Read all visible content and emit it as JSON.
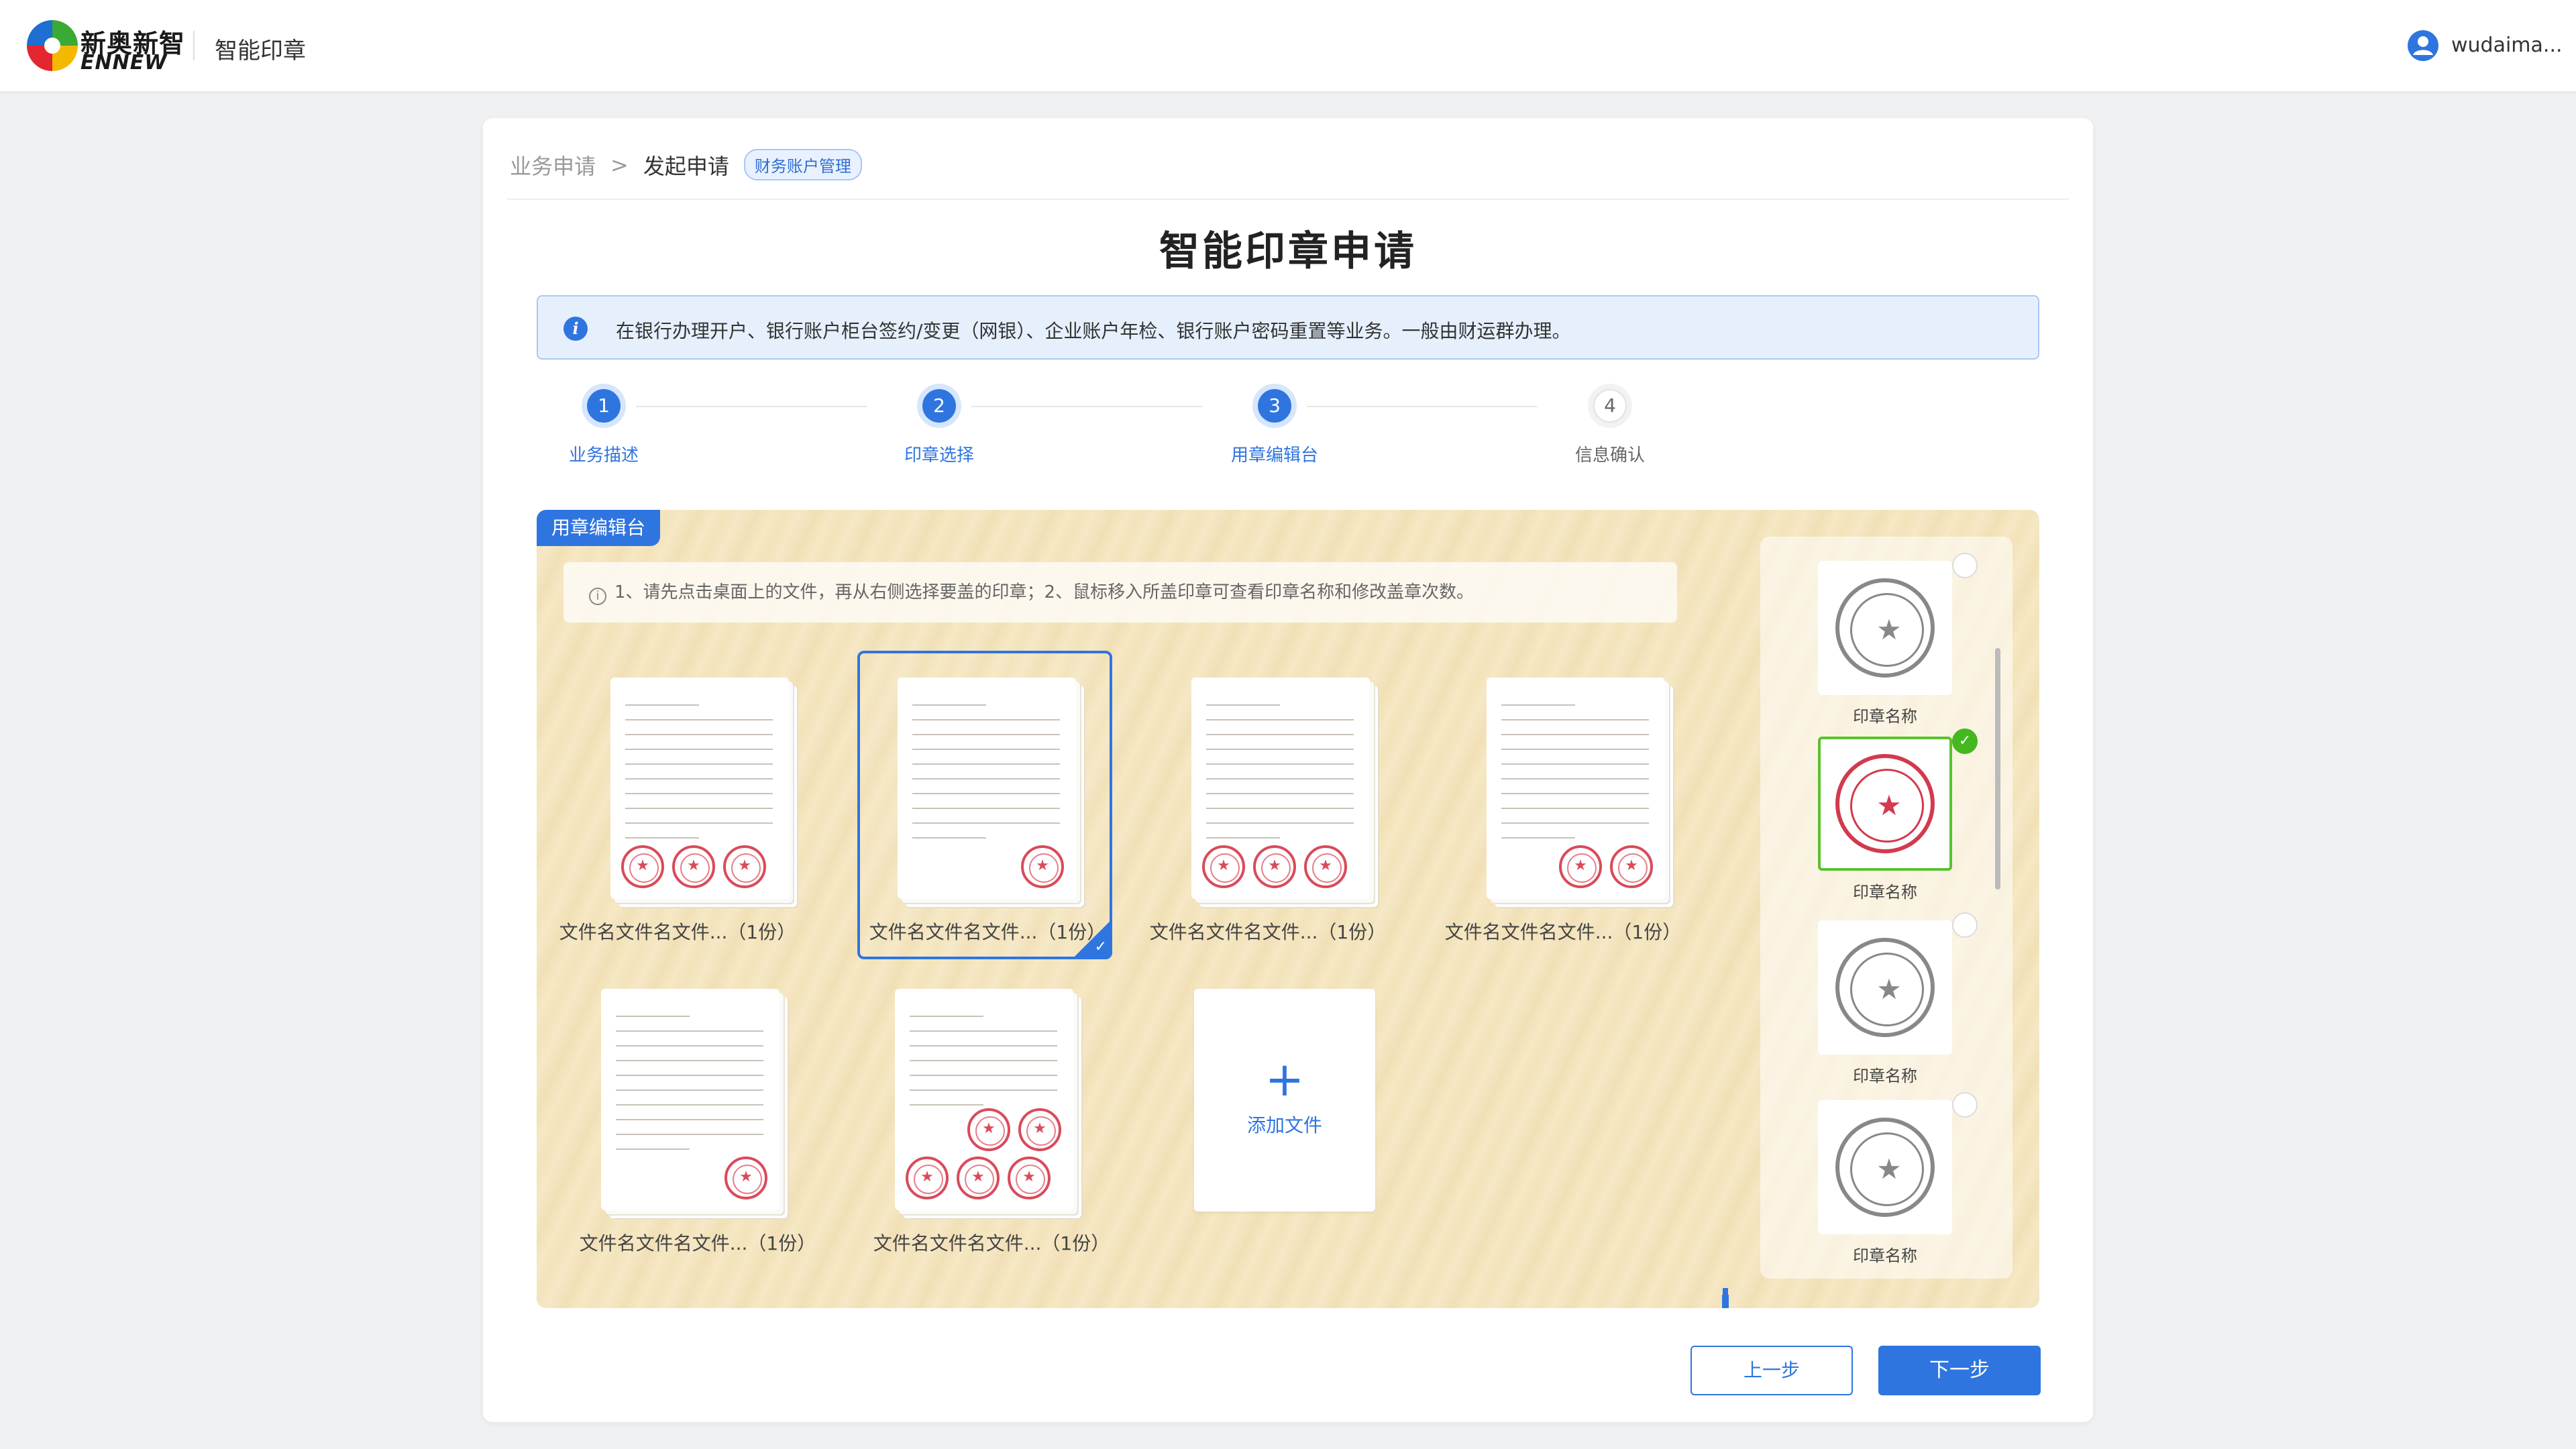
{
  "header": {
    "brand_cn": "新奥新智",
    "brand_en": "ENNEW",
    "app_title": "智能印章",
    "user_name": "wudaima...",
    "colors": {
      "logo_blue": "#1d6fd1",
      "logo_green": "#3aa935",
      "logo_yellow": "#f5b800",
      "logo_red": "#e3262f"
    }
  },
  "breadcrumb": {
    "parent": "业务申请",
    "separator": ">",
    "current": "发起申请",
    "tag": "财务账户管理"
  },
  "page_title": "智能印章申请",
  "notice": {
    "icon": "info-icon",
    "text": "在银行办理开户、银行账户柜台签约/变更（网银）、企业账户年检、银行账户密码重置等业务。一般由财运群办理。"
  },
  "steps": [
    {
      "num": "1",
      "label": "业务描述",
      "state": "done"
    },
    {
      "num": "2",
      "label": "印章选择",
      "state": "done"
    },
    {
      "num": "3",
      "label": "用章编辑台",
      "state": "current"
    },
    {
      "num": "4",
      "label": "信息确认",
      "state": "todo"
    }
  ],
  "workbench": {
    "tag": "用章编辑台",
    "tip": "1、请先点击桌面上的文件，再从右侧选择要盖的印章；2、鼠标移入所盖印章可查看印章名称和修改盖章次数。",
    "files": [
      {
        "caption": "文件名文件名文件...（1份）",
        "seal_count": 3,
        "selected": false
      },
      {
        "caption": "文件名文件名文件...（1份）",
        "seal_count": 1,
        "selected": true
      },
      {
        "caption": "文件名文件名文件...（1份）",
        "seal_count": 3,
        "selected": false
      },
      {
        "caption": "文件名文件名文件...（1份）",
        "seal_count": 2,
        "selected": false
      },
      {
        "caption": "文件名文件名文件...（1份）",
        "seal_count": 1,
        "selected": false
      },
      {
        "caption": "文件名文件名文件...（1份）",
        "seal_count": 5,
        "selected": false
      }
    ],
    "add_file_label": "添加文件",
    "add_icon": "plus-icon",
    "seals": [
      {
        "name": "印章名称",
        "selected": false
      },
      {
        "name": "印章名称",
        "selected": true
      },
      {
        "name": "印章名称",
        "selected": false
      },
      {
        "name": "印章名称",
        "selected": false
      }
    ],
    "seal_color": "#d23a4d"
  },
  "footer": {
    "prev_label": "上一步",
    "next_label": "下一步"
  },
  "accent_color": "#2f75e0"
}
